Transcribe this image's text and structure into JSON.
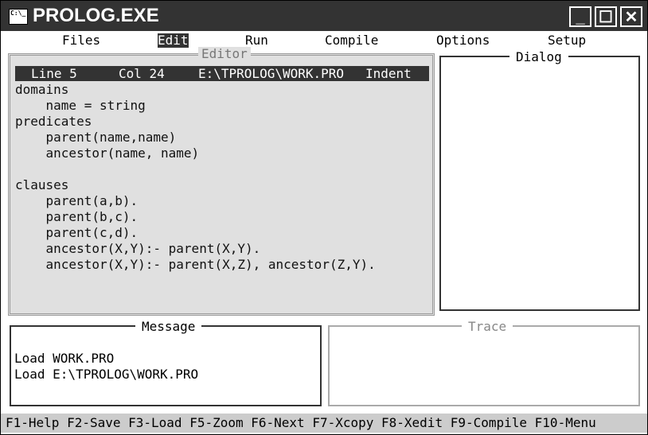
{
  "window": {
    "title": "PROLOG.EXE",
    "icon_text": "C:\\_",
    "minimize": "_",
    "maximize": "☐",
    "close": "✕"
  },
  "menu": {
    "items": [
      {
        "label": "Files"
      },
      {
        "label": "Edit",
        "active": true
      },
      {
        "label": "Run"
      },
      {
        "label": "Compile"
      },
      {
        "label": "Options"
      },
      {
        "label": "Setup"
      }
    ]
  },
  "editor": {
    "title": "Editor",
    "status": {
      "line": "Line 5",
      "col": "Col 24",
      "file": "E:\\TPROLOG\\WORK.PRO",
      "mode": "Indent"
    },
    "lines": [
      "domains",
      "    name = string",
      "predicates",
      "    parent(name,name)",
      "    ancestor(name, name)",
      "",
      "clauses",
      "    parent(a,b).",
      "    parent(b,c).",
      "    parent(c,d).",
      "    ancestor(X,Y):- parent(X,Y).",
      "    ancestor(X,Y):- parent(X,Z), ancestor(Z,Y)."
    ]
  },
  "dialog": {
    "title": "Dialog"
  },
  "message": {
    "title": "Message",
    "lines": [
      "Load WORK.PRO",
      "Load E:\\TPROLOG\\WORK.PRO"
    ]
  },
  "trace": {
    "title": "Trace"
  },
  "function_keys": "F1-Help F2-Save F3-Load F5-Zoom F6-Next F7-Xcopy F8-Xedit F9-Compile F10-Menu",
  "colors": {
    "titlebar": "#333333",
    "editor_bg": "#e0e0e0",
    "status_bg": "#333333",
    "fkeys_bg": "#cccccc"
  }
}
